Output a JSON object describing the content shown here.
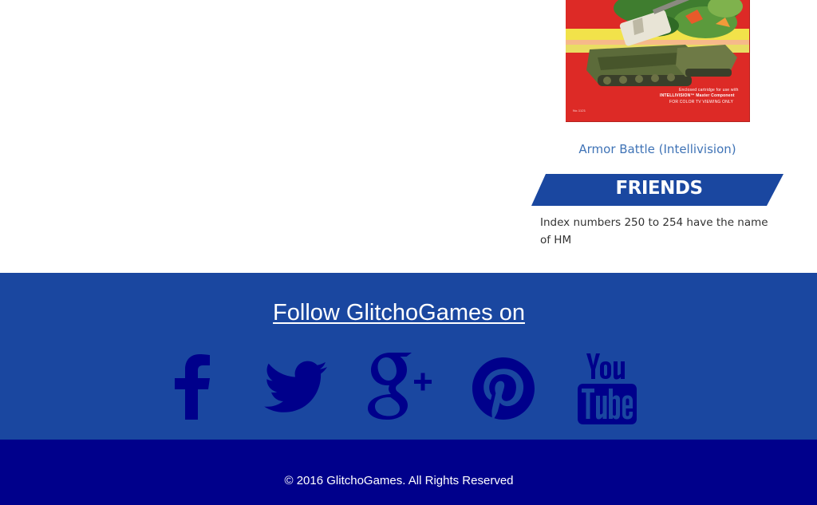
{
  "sidebar": {
    "box_art": {
      "line1": "Enclosed cartridge for use with",
      "line2": "INTELLIVISION™ Master Component",
      "line3": "FOR COLOR TV VIEWING ONLY",
      "number": "No.1121"
    },
    "game_link": "Armor Battle (Intellivision)",
    "friends_title": "FRIENDS",
    "friends_text": "Index numbers 250 to 254 have the name of HM"
  },
  "follow": {
    "heading": "Follow GlitchoGames on",
    "icons": [
      "facebook-icon",
      "twitter-icon",
      "google-plus-icon",
      "pinterest-icon",
      "youtube-icon"
    ]
  },
  "footer": {
    "copyright": "© 2016 GlitchoGames. All Rights Reserved"
  },
  "colors": {
    "link": "#3f73b6",
    "banner": "#1a47a0",
    "follow_band": "#1a47a0",
    "social_icons": "#00008b",
    "footer": "#00008b",
    "box_art_red": "#dd2a26"
  }
}
